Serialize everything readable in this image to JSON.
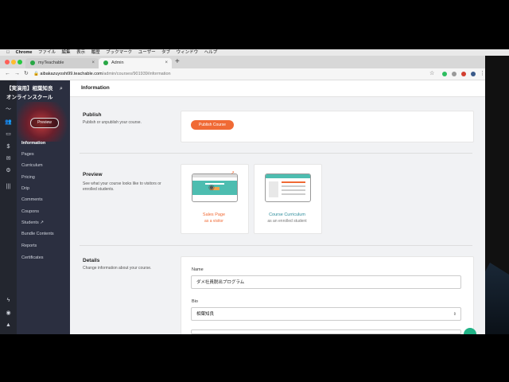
{
  "menubar": {
    "app": "Chrome",
    "items": [
      "ファイル",
      "編集",
      "表示",
      "履歴",
      "ブックマーク",
      "ユーザー",
      "タブ",
      "ウィンドウ",
      "ヘルプ"
    ]
  },
  "browser": {
    "tabs": [
      {
        "label": "myTeachable"
      },
      {
        "label": "Admin"
      }
    ],
    "url_host": "aibakazuyoshi99.teachable.com",
    "url_path": "/admin/courses/901939/information",
    "new_tab": "+"
  },
  "sidebar": {
    "school_name": "【実演用】相葉知良オンラインスクール",
    "preview_label": "Preview",
    "nav": [
      {
        "label": "Information",
        "active": true
      },
      {
        "label": "Pages"
      },
      {
        "label": "Curriculum"
      },
      {
        "label": "Pricing"
      },
      {
        "label": "Drip"
      },
      {
        "label": "Comments"
      },
      {
        "label": "Coupons"
      },
      {
        "label": "Students"
      },
      {
        "label": "Bundle Contents"
      },
      {
        "label": "Reports"
      },
      {
        "label": "Certificates"
      }
    ],
    "rail_icons": [
      "chart-icon",
      "users-icon",
      "site-icon",
      "dollar-icon",
      "mail-icon",
      "gear-icon",
      "library-icon",
      "bolt-icon",
      "user-circle-icon",
      "graduation-icon"
    ]
  },
  "page": {
    "title": "Information",
    "publish": {
      "title": "Publish",
      "desc": "Publish or unpublish your course.",
      "button": "Publish Course"
    },
    "preview": {
      "title": "Preview",
      "desc": "See what your course looks like to visitors or enrolled students.",
      "sales_label": "Sales Page",
      "sales_sub": "as a visitor",
      "curriculum_label": "Course Curriculum",
      "curriculum_sub": "as an enrolled student"
    },
    "details": {
      "title": "Details",
      "desc": "Change information about your course.",
      "name_label": "Name",
      "name_value": "ダメ社員脱出プログラム",
      "bio_label": "Bio",
      "bio_value": "相葉知良"
    }
  },
  "colors": {
    "accent_orange": "#f06a35",
    "sidebar_bg": "#2b2f40",
    "link_teal": "#2a8b9a",
    "fab_green": "#20b286"
  }
}
